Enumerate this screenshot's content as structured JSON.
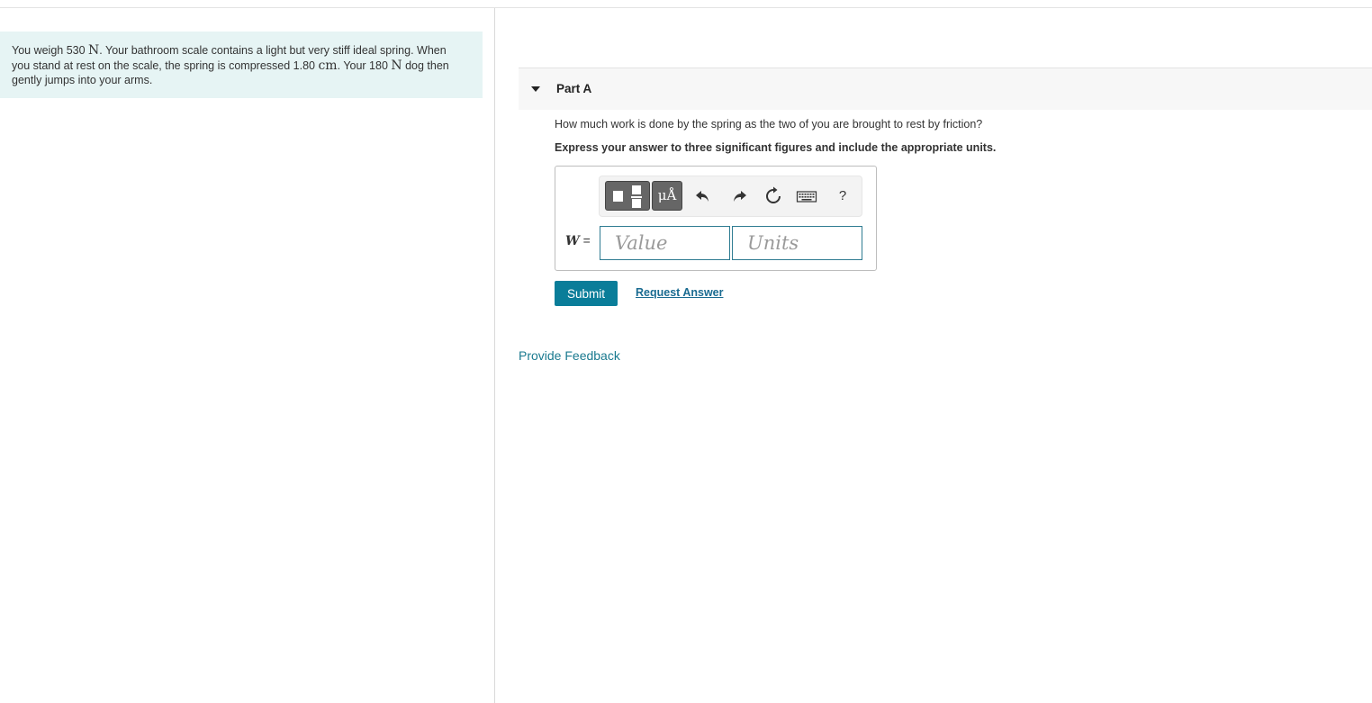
{
  "problem": {
    "t1": "You weigh 530 ",
    "unit_N": "N",
    "t2": ". Your bathroom scale contains a light but very stiff ideal spring. When you stand at rest on the scale, the spring is compressed 1.80 ",
    "unit_cm": "cm",
    "t3": ". Your 180 ",
    "unit_N2": "N",
    "t4": " dog then gently jumps into your arms."
  },
  "part": {
    "title": "Part A",
    "question": "How much work is done by the spring as the two of you are brought to rest by friction?",
    "instruction": "Express your answer to three significant figures and include the appropriate units."
  },
  "toolbar": {
    "templates_icon": "templates-icon",
    "units_symbol": "μÅ",
    "undo_icon": "undo-icon",
    "redo_icon": "redo-icon",
    "reset_icon": "reset-icon",
    "keyboard_icon": "keyboard-icon",
    "help_label": "?"
  },
  "answer": {
    "variable": "W",
    "equals": " =",
    "value_placeholder": "Value",
    "units_placeholder": "Units"
  },
  "actions": {
    "submit_label": "Submit",
    "request_answer_label": "Request Answer"
  },
  "footer": {
    "feedback_label": "Provide Feedback"
  },
  "colors": {
    "problem_bg": "#e6f4f4",
    "submit_bg": "#0a7d99",
    "link": "#1a6b91",
    "field_border": "#2f7c92"
  }
}
